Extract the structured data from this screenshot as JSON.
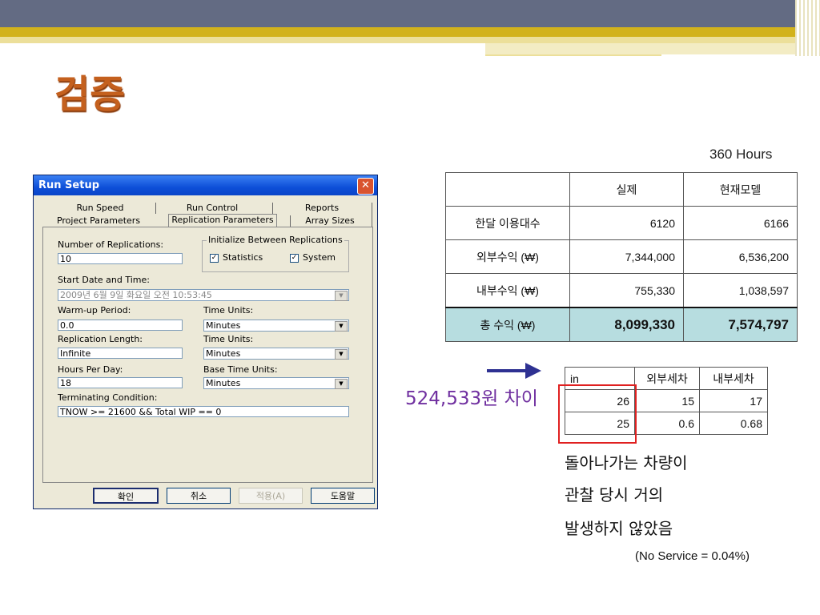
{
  "slide": {
    "title": "검증",
    "hours_label": "360 Hours",
    "difference_label": "524,533원 차이",
    "notes": [
      "돌아나가는 차량이",
      "관찰 당시 거의",
      "발생하지 않았음"
    ],
    "no_service": "(No Service = 0.04%)"
  },
  "main_table": {
    "headers": [
      "",
      "실제",
      "현재모델"
    ],
    "rows": [
      {
        "label": "한달 이용대수",
        "actual": "6120",
        "model": "6166"
      },
      {
        "label": "외부수익 (₩)",
        "actual": "7,344,000",
        "model": "6,536,200"
      },
      {
        "label": "내부수익 (₩)",
        "actual": "755,330",
        "model": "1,038,597"
      },
      {
        "label": "총 수익 (₩)",
        "actual": "8,099,330",
        "model": "7,574,797"
      }
    ]
  },
  "small_table": {
    "headers": [
      "in",
      "외부세차",
      "내부세차"
    ],
    "rows": [
      [
        "26",
        "15",
        "17"
      ],
      [
        "25",
        "0.6",
        "0.68"
      ]
    ]
  },
  "dialog": {
    "title": "Run Setup",
    "tabs_back": [
      "Run Speed",
      "Run Control",
      "Reports"
    ],
    "tabs_front": [
      "Project Parameters",
      "Replication Parameters",
      "Array Sizes"
    ],
    "num_replications_label": "Number of Replications:",
    "num_replications_value": "10",
    "init_group_label": "Initialize Between Replications",
    "statistics_label": "Statistics",
    "system_label": "System",
    "start_label": "Start Date and Time:",
    "start_value": "2009년  6월  9일 화요일  오전 10:53:45",
    "warmup_label": "Warm-up Period:",
    "warmup_value": "0.0",
    "time_units_label": "Time Units:",
    "warmup_units": "Minutes",
    "rep_length_label": "Replication Length:",
    "rep_length_value": "Infinite",
    "time_units_label2": "Time Units:",
    "rep_length_units": "Minutes",
    "hours_per_day_label": "Hours Per Day:",
    "hours_per_day_value": "18",
    "base_units_label": "Base Time Units:",
    "base_units_value": "Minutes",
    "terminating_label": "Terminating Condition:",
    "terminating_value": "TNOW >= 21600 && Total WIP == 0",
    "buttons": {
      "ok": "확인",
      "cancel": "취소",
      "apply": "적용(A)",
      "help": "도움말"
    }
  },
  "colors": {
    "title": "#c4601e",
    "difference": "#7030a0",
    "arrow": "#2e3192",
    "total_row": "#b7dde0",
    "highlight_box": "#e02020"
  }
}
